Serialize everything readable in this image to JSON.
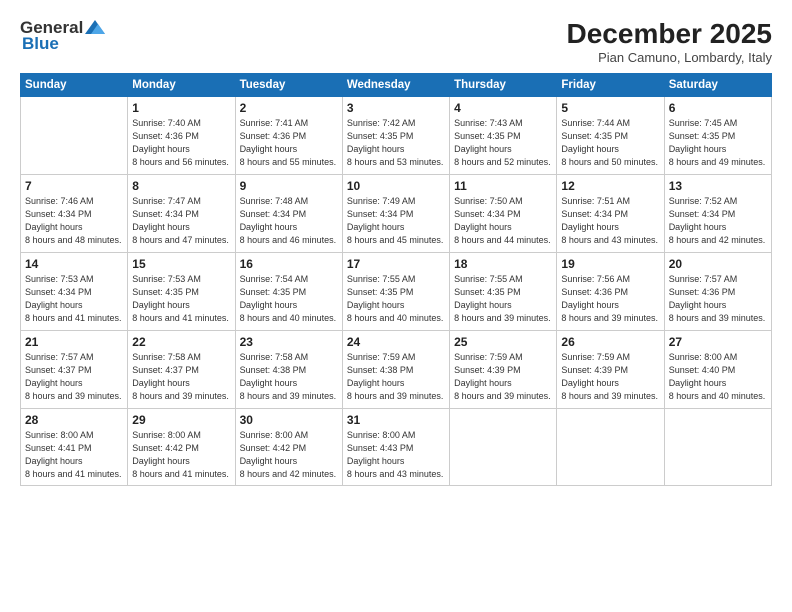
{
  "logo": {
    "general": "General",
    "blue": "Blue"
  },
  "header": {
    "month": "December 2025",
    "location": "Pian Camuno, Lombardy, Italy"
  },
  "weekdays": [
    "Sunday",
    "Monday",
    "Tuesday",
    "Wednesday",
    "Thursday",
    "Friday",
    "Saturday"
  ],
  "weeks": [
    [
      {
        "day": null
      },
      {
        "day": "1",
        "sunrise": "7:40 AM",
        "sunset": "4:36 PM",
        "daylight": "8 hours and 56 minutes."
      },
      {
        "day": "2",
        "sunrise": "7:41 AM",
        "sunset": "4:36 PM",
        "daylight": "8 hours and 55 minutes."
      },
      {
        "day": "3",
        "sunrise": "7:42 AM",
        "sunset": "4:35 PM",
        "daylight": "8 hours and 53 minutes."
      },
      {
        "day": "4",
        "sunrise": "7:43 AM",
        "sunset": "4:35 PM",
        "daylight": "8 hours and 52 minutes."
      },
      {
        "day": "5",
        "sunrise": "7:44 AM",
        "sunset": "4:35 PM",
        "daylight": "8 hours and 50 minutes."
      },
      {
        "day": "6",
        "sunrise": "7:45 AM",
        "sunset": "4:35 PM",
        "daylight": "8 hours and 49 minutes."
      }
    ],
    [
      {
        "day": "7",
        "sunrise": "7:46 AM",
        "sunset": "4:34 PM",
        "daylight": "8 hours and 48 minutes."
      },
      {
        "day": "8",
        "sunrise": "7:47 AM",
        "sunset": "4:34 PM",
        "daylight": "8 hours and 47 minutes."
      },
      {
        "day": "9",
        "sunrise": "7:48 AM",
        "sunset": "4:34 PM",
        "daylight": "8 hours and 46 minutes."
      },
      {
        "day": "10",
        "sunrise": "7:49 AM",
        "sunset": "4:34 PM",
        "daylight": "8 hours and 45 minutes."
      },
      {
        "day": "11",
        "sunrise": "7:50 AM",
        "sunset": "4:34 PM",
        "daylight": "8 hours and 44 minutes."
      },
      {
        "day": "12",
        "sunrise": "7:51 AM",
        "sunset": "4:34 PM",
        "daylight": "8 hours and 43 minutes."
      },
      {
        "day": "13",
        "sunrise": "7:52 AM",
        "sunset": "4:34 PM",
        "daylight": "8 hours and 42 minutes."
      }
    ],
    [
      {
        "day": "14",
        "sunrise": "7:53 AM",
        "sunset": "4:34 PM",
        "daylight": "8 hours and 41 minutes."
      },
      {
        "day": "15",
        "sunrise": "7:53 AM",
        "sunset": "4:35 PM",
        "daylight": "8 hours and 41 minutes."
      },
      {
        "day": "16",
        "sunrise": "7:54 AM",
        "sunset": "4:35 PM",
        "daylight": "8 hours and 40 minutes."
      },
      {
        "day": "17",
        "sunrise": "7:55 AM",
        "sunset": "4:35 PM",
        "daylight": "8 hours and 40 minutes."
      },
      {
        "day": "18",
        "sunrise": "7:55 AM",
        "sunset": "4:35 PM",
        "daylight": "8 hours and 39 minutes."
      },
      {
        "day": "19",
        "sunrise": "7:56 AM",
        "sunset": "4:36 PM",
        "daylight": "8 hours and 39 minutes."
      },
      {
        "day": "20",
        "sunrise": "7:57 AM",
        "sunset": "4:36 PM",
        "daylight": "8 hours and 39 minutes."
      }
    ],
    [
      {
        "day": "21",
        "sunrise": "7:57 AM",
        "sunset": "4:37 PM",
        "daylight": "8 hours and 39 minutes."
      },
      {
        "day": "22",
        "sunrise": "7:58 AM",
        "sunset": "4:37 PM",
        "daylight": "8 hours and 39 minutes."
      },
      {
        "day": "23",
        "sunrise": "7:58 AM",
        "sunset": "4:38 PM",
        "daylight": "8 hours and 39 minutes."
      },
      {
        "day": "24",
        "sunrise": "7:59 AM",
        "sunset": "4:38 PM",
        "daylight": "8 hours and 39 minutes."
      },
      {
        "day": "25",
        "sunrise": "7:59 AM",
        "sunset": "4:39 PM",
        "daylight": "8 hours and 39 minutes."
      },
      {
        "day": "26",
        "sunrise": "7:59 AM",
        "sunset": "4:39 PM",
        "daylight": "8 hours and 39 minutes."
      },
      {
        "day": "27",
        "sunrise": "8:00 AM",
        "sunset": "4:40 PM",
        "daylight": "8 hours and 40 minutes."
      }
    ],
    [
      {
        "day": "28",
        "sunrise": "8:00 AM",
        "sunset": "4:41 PM",
        "daylight": "8 hours and 41 minutes."
      },
      {
        "day": "29",
        "sunrise": "8:00 AM",
        "sunset": "4:42 PM",
        "daylight": "8 hours and 41 minutes."
      },
      {
        "day": "30",
        "sunrise": "8:00 AM",
        "sunset": "4:42 PM",
        "daylight": "8 hours and 42 minutes."
      },
      {
        "day": "31",
        "sunrise": "8:00 AM",
        "sunset": "4:43 PM",
        "daylight": "8 hours and 43 minutes."
      },
      {
        "day": null
      },
      {
        "day": null
      },
      {
        "day": null
      }
    ]
  ]
}
